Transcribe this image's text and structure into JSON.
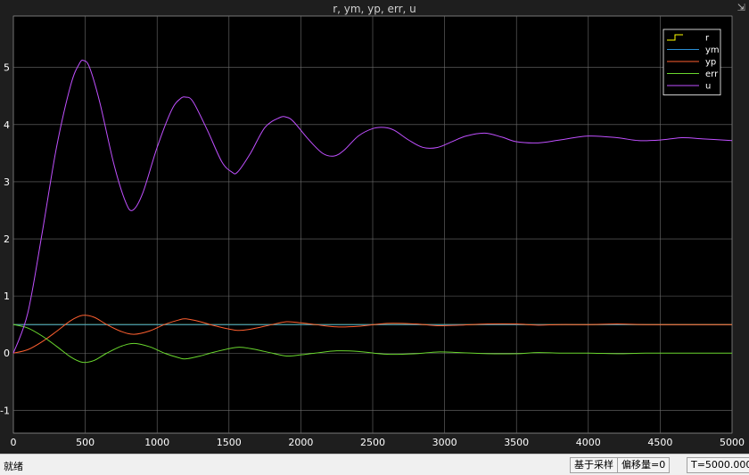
{
  "window": {
    "title": "r, ym, yp, err, u"
  },
  "status": {
    "ready": "就绪",
    "sampling": "基于采样",
    "offset": "偏移量=0",
    "time": "T=5000.000"
  },
  "colors": {
    "background": "#000000",
    "frame": "#1e1e1e",
    "grid": "#6e6e6e",
    "tick_text": "#ffffff"
  },
  "chart_data": {
    "type": "line",
    "title": "r, ym, yp, err, u",
    "xlabel": "",
    "ylabel": "",
    "xlim": [
      0,
      5000
    ],
    "ylim": [
      -1.4,
      5.9
    ],
    "xticks": [
      0,
      500,
      1000,
      1500,
      2000,
      2500,
      3000,
      3500,
      4000,
      4500,
      5000
    ],
    "yticks": [
      -1,
      0,
      1,
      2,
      3,
      4,
      5
    ],
    "grid": true,
    "legend": "top-right",
    "series": [
      {
        "name": "r",
        "color": "#ffff00",
        "legend_style": "step",
        "x": [
          0,
          5000
        ],
        "y": [
          0.5,
          0.5
        ]
      },
      {
        "name": "ym",
        "color": "#2b8fd6",
        "x": [
          0,
          5000
        ],
        "y": [
          0.5,
          0.5
        ]
      },
      {
        "name": "yp",
        "color": "#ff6030",
        "x": [
          0,
          100,
          200,
          300,
          400,
          480,
          560,
          650,
          750,
          840,
          950,
          1050,
          1150,
          1200,
          1300,
          1400,
          1550,
          1650,
          1800,
          1900,
          2000,
          2100,
          2250,
          2400,
          2600,
          2800,
          2950,
          3100,
          3300,
          3500,
          3650,
          3800,
          4000,
          4200,
          4400,
          4650,
          4800,
          5000
        ],
        "y": [
          0,
          0.06,
          0.2,
          0.38,
          0.57,
          0.66,
          0.63,
          0.5,
          0.38,
          0.33,
          0.39,
          0.5,
          0.58,
          0.6,
          0.55,
          0.48,
          0.4,
          0.42,
          0.5,
          0.55,
          0.53,
          0.5,
          0.46,
          0.47,
          0.52,
          0.51,
          0.48,
          0.49,
          0.51,
          0.51,
          0.49,
          0.5,
          0.5,
          0.51,
          0.5,
          0.5,
          0.5,
          0.5
        ]
      },
      {
        "name": "err",
        "color": "#6ad82e",
        "x": [
          0,
          100,
          200,
          300,
          400,
          480,
          560,
          650,
          750,
          840,
          950,
          1050,
          1150,
          1200,
          1300,
          1400,
          1550,
          1650,
          1800,
          1900,
          2000,
          2100,
          2250,
          2400,
          2600,
          2800,
          2950,
          3100,
          3300,
          3500,
          3650,
          3800,
          4000,
          4200,
          4400,
          4650,
          4800,
          5000
        ],
        "y": [
          0.5,
          0.44,
          0.3,
          0.12,
          -0.07,
          -0.16,
          -0.13,
          0,
          0.12,
          0.17,
          0.11,
          0,
          -0.08,
          -0.1,
          -0.05,
          0.02,
          0.1,
          0.08,
          0,
          -0.05,
          -0.03,
          0,
          0.04,
          0.03,
          -0.02,
          -0.01,
          0.02,
          0.01,
          -0.01,
          -0.01,
          0.01,
          0,
          0,
          -0.01,
          0,
          0,
          0,
          0
        ]
      },
      {
        "name": "u",
        "color": "#c050ff",
        "x": [
          0,
          100,
          200,
          300,
          400,
          460,
          490,
          530,
          600,
          700,
          780,
          830,
          900,
          1000,
          1100,
          1160,
          1200,
          1250,
          1350,
          1450,
          1520,
          1560,
          1650,
          1750,
          1850,
          1900,
          1950,
          2050,
          2150,
          2230,
          2300,
          2400,
          2500,
          2580,
          2650,
          2750,
          2850,
          2950,
          3050,
          3150,
          3280,
          3400,
          3500,
          3650,
          3800,
          4000,
          4200,
          4350,
          4500,
          4650,
          4800,
          5000
        ],
        "y": [
          0,
          0.7,
          2.1,
          3.6,
          4.7,
          5.07,
          5.12,
          5.0,
          4.4,
          3.3,
          2.65,
          2.5,
          2.8,
          3.6,
          4.25,
          4.45,
          4.48,
          4.4,
          3.9,
          3.35,
          3.17,
          3.17,
          3.5,
          3.95,
          4.12,
          4.13,
          4.05,
          3.75,
          3.5,
          3.45,
          3.55,
          3.8,
          3.93,
          3.95,
          3.9,
          3.73,
          3.6,
          3.6,
          3.7,
          3.8,
          3.85,
          3.78,
          3.7,
          3.68,
          3.73,
          3.8,
          3.77,
          3.72,
          3.73,
          3.77,
          3.75,
          3.72
        ]
      }
    ]
  }
}
